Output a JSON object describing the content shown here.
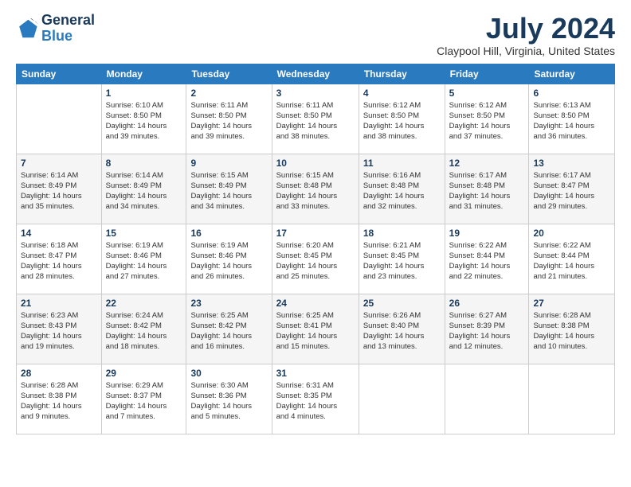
{
  "logo": {
    "line1": "General",
    "line2": "Blue"
  },
  "title": "July 2024",
  "location": "Claypool Hill, Virginia, United States",
  "weekdays": [
    "Sunday",
    "Monday",
    "Tuesday",
    "Wednesday",
    "Thursday",
    "Friday",
    "Saturday"
  ],
  "weeks": [
    [
      {
        "day": "",
        "info": ""
      },
      {
        "day": "1",
        "info": "Sunrise: 6:10 AM\nSunset: 8:50 PM\nDaylight: 14 hours\nand 39 minutes."
      },
      {
        "day": "2",
        "info": "Sunrise: 6:11 AM\nSunset: 8:50 PM\nDaylight: 14 hours\nand 39 minutes."
      },
      {
        "day": "3",
        "info": "Sunrise: 6:11 AM\nSunset: 8:50 PM\nDaylight: 14 hours\nand 38 minutes."
      },
      {
        "day": "4",
        "info": "Sunrise: 6:12 AM\nSunset: 8:50 PM\nDaylight: 14 hours\nand 38 minutes."
      },
      {
        "day": "5",
        "info": "Sunrise: 6:12 AM\nSunset: 8:50 PM\nDaylight: 14 hours\nand 37 minutes."
      },
      {
        "day": "6",
        "info": "Sunrise: 6:13 AM\nSunset: 8:50 PM\nDaylight: 14 hours\nand 36 minutes."
      }
    ],
    [
      {
        "day": "7",
        "info": "Sunrise: 6:14 AM\nSunset: 8:49 PM\nDaylight: 14 hours\nand 35 minutes."
      },
      {
        "day": "8",
        "info": "Sunrise: 6:14 AM\nSunset: 8:49 PM\nDaylight: 14 hours\nand 34 minutes."
      },
      {
        "day": "9",
        "info": "Sunrise: 6:15 AM\nSunset: 8:49 PM\nDaylight: 14 hours\nand 34 minutes."
      },
      {
        "day": "10",
        "info": "Sunrise: 6:15 AM\nSunset: 8:48 PM\nDaylight: 14 hours\nand 33 minutes."
      },
      {
        "day": "11",
        "info": "Sunrise: 6:16 AM\nSunset: 8:48 PM\nDaylight: 14 hours\nand 32 minutes."
      },
      {
        "day": "12",
        "info": "Sunrise: 6:17 AM\nSunset: 8:48 PM\nDaylight: 14 hours\nand 31 minutes."
      },
      {
        "day": "13",
        "info": "Sunrise: 6:17 AM\nSunset: 8:47 PM\nDaylight: 14 hours\nand 29 minutes."
      }
    ],
    [
      {
        "day": "14",
        "info": "Sunrise: 6:18 AM\nSunset: 8:47 PM\nDaylight: 14 hours\nand 28 minutes."
      },
      {
        "day": "15",
        "info": "Sunrise: 6:19 AM\nSunset: 8:46 PM\nDaylight: 14 hours\nand 27 minutes."
      },
      {
        "day": "16",
        "info": "Sunrise: 6:19 AM\nSunset: 8:46 PM\nDaylight: 14 hours\nand 26 minutes."
      },
      {
        "day": "17",
        "info": "Sunrise: 6:20 AM\nSunset: 8:45 PM\nDaylight: 14 hours\nand 25 minutes."
      },
      {
        "day": "18",
        "info": "Sunrise: 6:21 AM\nSunset: 8:45 PM\nDaylight: 14 hours\nand 23 minutes."
      },
      {
        "day": "19",
        "info": "Sunrise: 6:22 AM\nSunset: 8:44 PM\nDaylight: 14 hours\nand 22 minutes."
      },
      {
        "day": "20",
        "info": "Sunrise: 6:22 AM\nSunset: 8:44 PM\nDaylight: 14 hours\nand 21 minutes."
      }
    ],
    [
      {
        "day": "21",
        "info": "Sunrise: 6:23 AM\nSunset: 8:43 PM\nDaylight: 14 hours\nand 19 minutes."
      },
      {
        "day": "22",
        "info": "Sunrise: 6:24 AM\nSunset: 8:42 PM\nDaylight: 14 hours\nand 18 minutes."
      },
      {
        "day": "23",
        "info": "Sunrise: 6:25 AM\nSunset: 8:42 PM\nDaylight: 14 hours\nand 16 minutes."
      },
      {
        "day": "24",
        "info": "Sunrise: 6:25 AM\nSunset: 8:41 PM\nDaylight: 14 hours\nand 15 minutes."
      },
      {
        "day": "25",
        "info": "Sunrise: 6:26 AM\nSunset: 8:40 PM\nDaylight: 14 hours\nand 13 minutes."
      },
      {
        "day": "26",
        "info": "Sunrise: 6:27 AM\nSunset: 8:39 PM\nDaylight: 14 hours\nand 12 minutes."
      },
      {
        "day": "27",
        "info": "Sunrise: 6:28 AM\nSunset: 8:38 PM\nDaylight: 14 hours\nand 10 minutes."
      }
    ],
    [
      {
        "day": "28",
        "info": "Sunrise: 6:28 AM\nSunset: 8:38 PM\nDaylight: 14 hours\nand 9 minutes."
      },
      {
        "day": "29",
        "info": "Sunrise: 6:29 AM\nSunset: 8:37 PM\nDaylight: 14 hours\nand 7 minutes."
      },
      {
        "day": "30",
        "info": "Sunrise: 6:30 AM\nSunset: 8:36 PM\nDaylight: 14 hours\nand 5 minutes."
      },
      {
        "day": "31",
        "info": "Sunrise: 6:31 AM\nSunset: 8:35 PM\nDaylight: 14 hours\nand 4 minutes."
      },
      {
        "day": "",
        "info": ""
      },
      {
        "day": "",
        "info": ""
      },
      {
        "day": "",
        "info": ""
      }
    ]
  ]
}
